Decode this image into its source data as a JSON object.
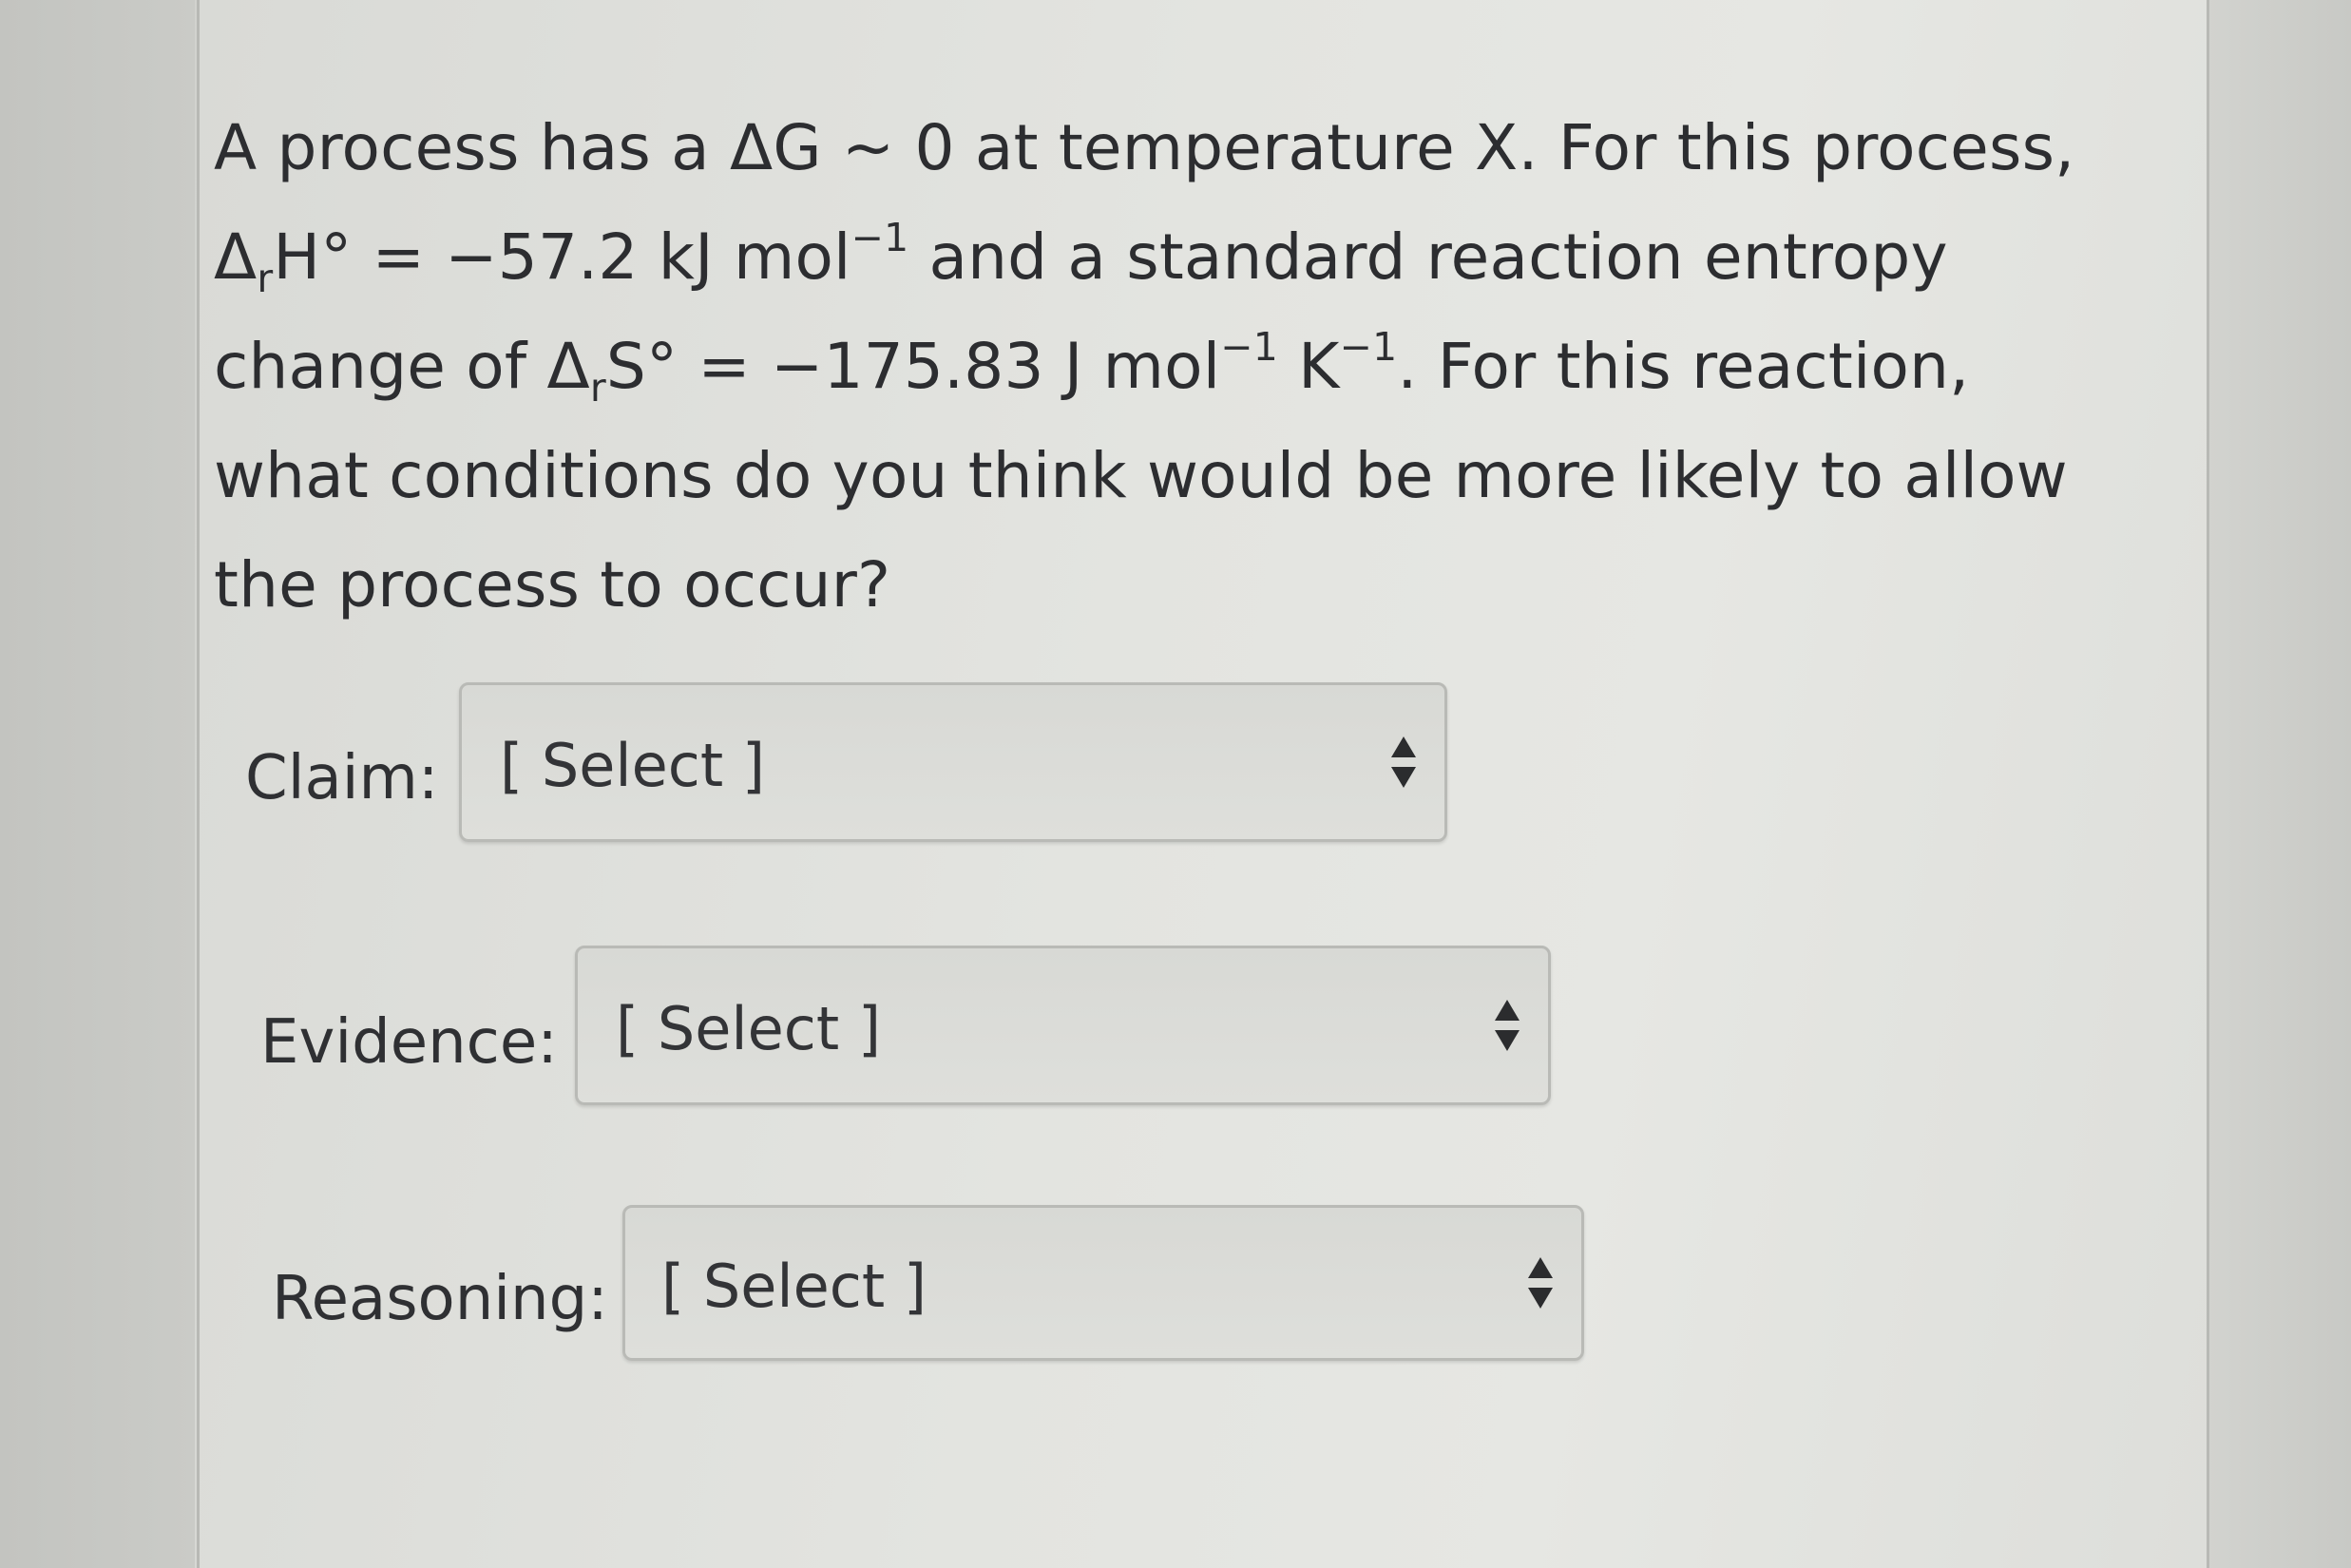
{
  "question": {
    "line1": "A process has a ΔG ~ 0 at temperature X. For this process,",
    "line2": {
      "delta": "Δ",
      "sub_r": "r",
      "H": "H° = −57.2 kJ mol",
      "exp": "−1",
      "rest": " and a standard reaction entropy"
    },
    "line3": {
      "pre": "change of Δ",
      "sub_r": "r",
      "S": "S° = −175.83 J mol",
      "exp1": "−1",
      "K": " K",
      "exp2": "−1",
      "rest": ". For this reaction,"
    },
    "line4": "what conditions do you think would be more likely to allow",
    "line5": "the process to occur?"
  },
  "fields": {
    "claim": {
      "label": "Claim:",
      "value": "[ Select ]"
    },
    "evidence": {
      "label": "Evidence:",
      "value": "[ Select ]"
    },
    "reasoning": {
      "label": "Reasoning:",
      "value": "[ Select ]"
    }
  },
  "icons": {
    "select_arrows": "up-down-chevron-icon"
  }
}
